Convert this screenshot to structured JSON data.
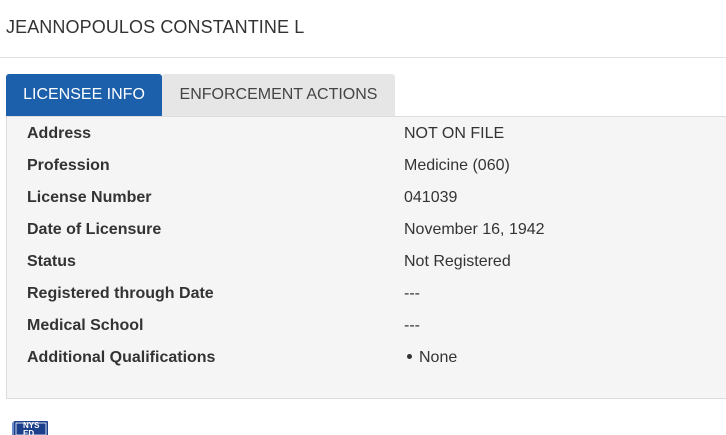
{
  "header": {
    "title": "JEANNOPOULOS CONSTANTINE L"
  },
  "tabs": [
    {
      "label": "LICENSEE INFO",
      "active": true
    },
    {
      "label": "ENFORCEMENT ACTIONS",
      "active": false
    }
  ],
  "licensee": {
    "rows": [
      {
        "label": "Address",
        "value": "NOT ON FILE"
      },
      {
        "label": "Profession",
        "value": "Medicine (060)"
      },
      {
        "label": "License Number",
        "value": "041039"
      },
      {
        "label": "Date of Licensure",
        "value": "November 16, 1942"
      },
      {
        "label": "Status",
        "value": "Not Registered"
      },
      {
        "label": "Registered through Date",
        "value": "---"
      },
      {
        "label": "Medical School",
        "value": "---"
      },
      {
        "label": "Additional Qualifications",
        "value": "None"
      }
    ]
  },
  "footer": {
    "logo_text": "NYS ED"
  },
  "colors": {
    "tab_active_bg": "#1c5fab",
    "tab_inactive_bg": "#e6e6e6",
    "panel_bg": "#f5f5f5"
  }
}
